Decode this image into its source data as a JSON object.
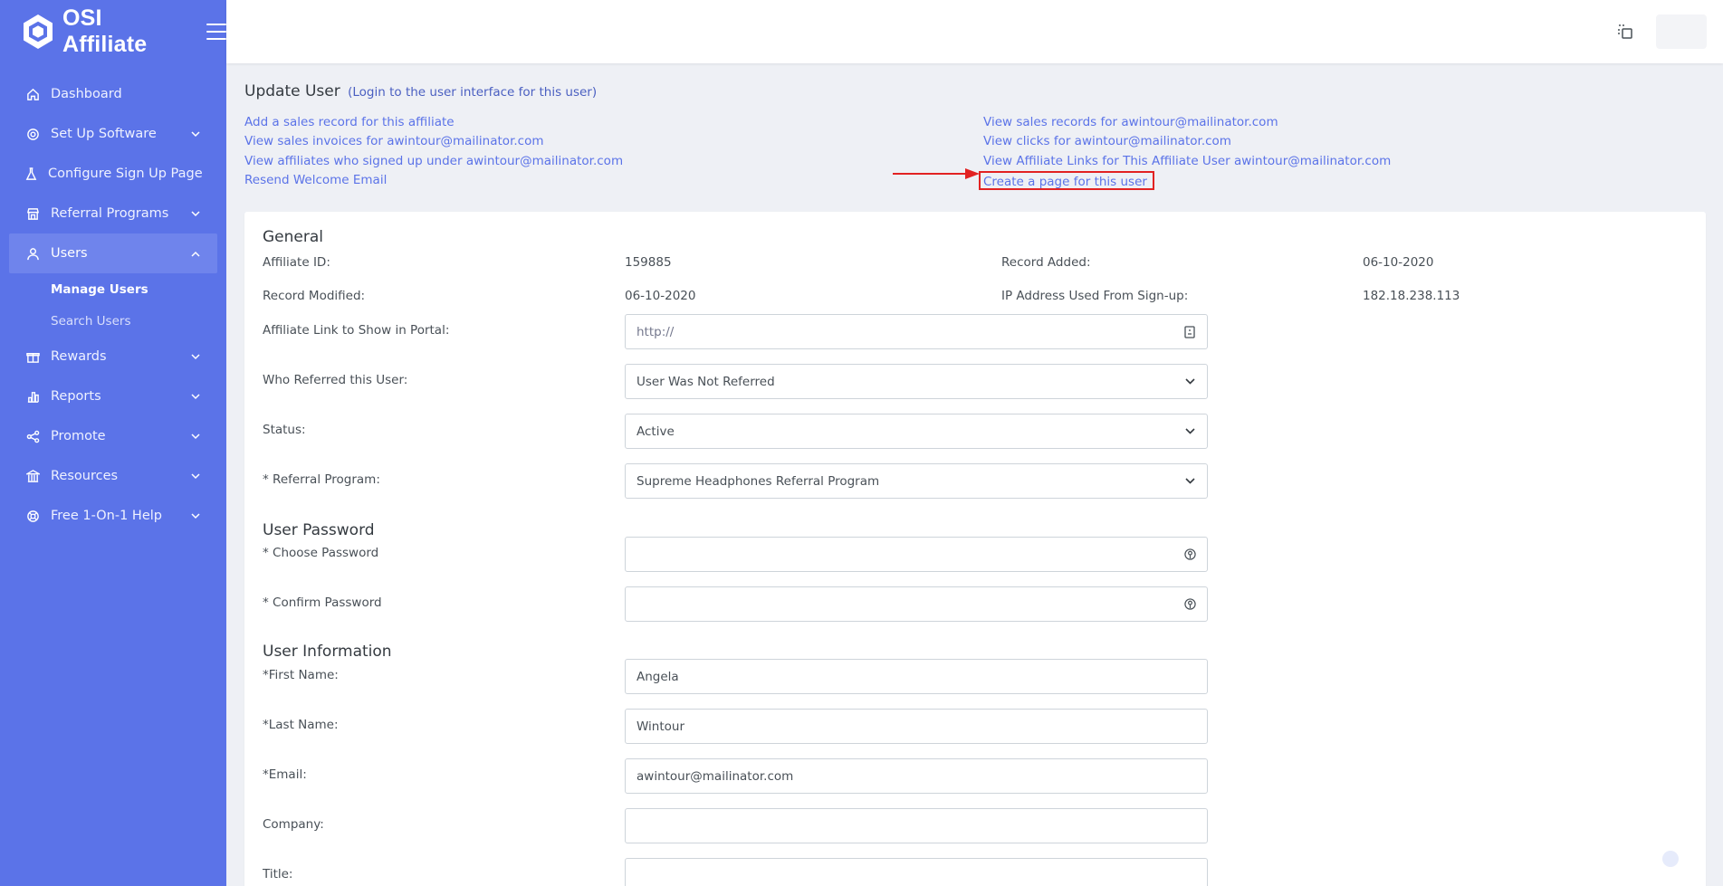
{
  "brand": {
    "name": "OSI Affiliate"
  },
  "sidebar": {
    "items": [
      {
        "label": "Dashboard",
        "icon": "home-icon",
        "expandable": false
      },
      {
        "label": "Set Up Software",
        "icon": "gear-icon",
        "expandable": true
      },
      {
        "label": "Configure Sign Up Page",
        "icon": "flask-icon",
        "expandable": false
      },
      {
        "label": "Referral Programs",
        "icon": "store-icon",
        "expandable": true
      },
      {
        "label": "Users",
        "icon": "user-icon",
        "expandable": true,
        "active": true
      },
      {
        "label": "Rewards",
        "icon": "gift-icon",
        "expandable": true
      },
      {
        "label": "Reports",
        "icon": "chart-icon",
        "expandable": true
      },
      {
        "label": "Promote",
        "icon": "share-icon",
        "expandable": true
      },
      {
        "label": "Resources",
        "icon": "bank-icon",
        "expandable": true
      },
      {
        "label": "Free 1-On-1 Help",
        "icon": "lifebuoy-icon",
        "expandable": true
      }
    ],
    "users_sub": [
      "Manage Users",
      "Search Users"
    ]
  },
  "page": {
    "title": "Update User",
    "login_link": "(Login to the user interface for this user)"
  },
  "links": {
    "left": [
      "Add a sales record for this affiliate",
      "View sales invoices for awintour@mailinator.com",
      "View affiliates who signed up under awintour@mailinator.com",
      "Resend Welcome Email"
    ],
    "right": [
      "View sales records for awintour@mailinator.com",
      "View clicks for awintour@mailinator.com",
      "View Affiliate Links for This Affiliate User awintour@mailinator.com",
      "Create a page for this user"
    ]
  },
  "general": {
    "title": "General",
    "affiliate_id_label": "Affiliate ID:",
    "affiliate_id": "159885",
    "record_added_label": "Record Added:",
    "record_added": "06-10-2020",
    "record_modified_label": "Record Modified:",
    "record_modified": "06-10-2020",
    "ip_label": "IP Address Used From Sign-up:",
    "ip": "182.18.238.113"
  },
  "form": {
    "affiliate_link_label": "Affiliate Link to Show in Portal:",
    "affiliate_link_placeholder": "http://",
    "referred_label": "Who Referred this User:",
    "referred_value": "User Was Not Referred",
    "status_label": "Status:",
    "status_value": "Active",
    "program_label": "* Referral Program:",
    "program_value": "Supreme Headphones Referral Program"
  },
  "password": {
    "title": "User Password",
    "choose_label": "* Choose Password",
    "confirm_label": "* Confirm Password"
  },
  "user_info": {
    "title": "User Information",
    "first_name_label": "*First Name:",
    "first_name": "Angela",
    "last_name_label": "*Last Name:",
    "last_name": "Wintour",
    "email_label": "*Email:",
    "email": "awintour@mailinator.com",
    "company_label": "Company:",
    "company": "",
    "title_label": "Title:"
  },
  "colors": {
    "sidebar": "#5b73e8",
    "link": "#5b73e8",
    "highlight": "#e22222"
  }
}
